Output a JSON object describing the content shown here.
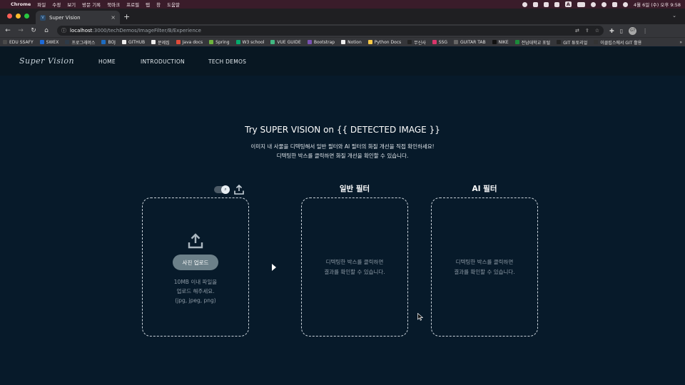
{
  "menubar": {
    "app_name": "Chrome",
    "menus": [
      "파일",
      "수정",
      "보기",
      "방문 기록",
      "북마크",
      "프로필",
      "탭",
      "창",
      "도움말"
    ],
    "datetime": "4월 6일 (수) 오후 9:58",
    "input_indicator": "A"
  },
  "browser": {
    "tab_title": "Super Vision",
    "tab_close": "×",
    "new_tab": "+",
    "url_host": "localhost",
    "url_path": ":3000/techDemos/ImageFilter/B/Experience",
    "profile_initials": "G7"
  },
  "bookmarks": [
    {
      "label": "EDU SSAFY",
      "color": "#4a4a4a"
    },
    {
      "label": "SWEX",
      "color": "#1e6ad9"
    },
    {
      "label": "프로그래머스",
      "color": "#2d3a48"
    },
    {
      "label": "BOJ",
      "color": "#1d6cc1"
    },
    {
      "label": "GITHUB",
      "color": "#eeeeee"
    },
    {
      "label": "문제집",
      "color": "#eeeeee"
    },
    {
      "label": "Java docs",
      "color": "#e04b3a"
    },
    {
      "label": "Spring",
      "color": "#6db33f"
    },
    {
      "label": "W3 school",
      "color": "#04aa6d"
    },
    {
      "label": "VUE GUIDE",
      "color": "#41b883"
    },
    {
      "label": "Bootstrap",
      "color": "#7952b3"
    },
    {
      "label": "Notion",
      "color": "#eeeeee"
    },
    {
      "label": "Python Docs",
      "color": "#f7c948"
    },
    {
      "label": "무신사",
      "color": "#222222"
    },
    {
      "label": "SSG",
      "color": "#d9356b"
    },
    {
      "label": "GUITAR TAB",
      "color": "#666666"
    },
    {
      "label": "NIKE",
      "color": "#111111"
    },
    {
      "label": "전남대학교 포털",
      "color": "#1b8a3a"
    },
    {
      "label": "GIT 튜토리얼",
      "color": "#222222"
    },
    {
      "label": "이클립스에서 GIT 활용",
      "color": "#333333"
    }
  ],
  "site": {
    "logo": "Super Vision",
    "nav": [
      "HOME",
      "INTRODUCTION",
      "TECH DEMOS"
    ]
  },
  "hero": {
    "title": "Try SUPER VISION on {{ DETECTED IMAGE }}",
    "sub1": "이미지 내 사물을 디텍팅해서 일반 필터와 AI 필터의 화질 개선을 직접 확인하세요!",
    "sub2": "디텍팅한 박스를 클릭하면 화질 개선을 확인할 수 있습니다."
  },
  "upload_panel": {
    "button_label": "사진 업로드",
    "note1": "10MB 이내 파일을",
    "note2": "업로드 해주세요.",
    "note3": "(jpg, jpeg, png)"
  },
  "normal_panel": {
    "title": "일반 필터",
    "line1": "디텍팅한 박스를 클릭하면",
    "line2": "결과를 확인할 수 있습니다."
  },
  "ai_panel": {
    "title": "AI 필터",
    "line1": "디텍팅한 박스를 클릭하면",
    "line2": "결과를 확인할 수 있습니다."
  },
  "icons": {
    "upload": "upload-icon",
    "toggle": "detect-toggle",
    "arrow": "play-arrow-icon"
  }
}
